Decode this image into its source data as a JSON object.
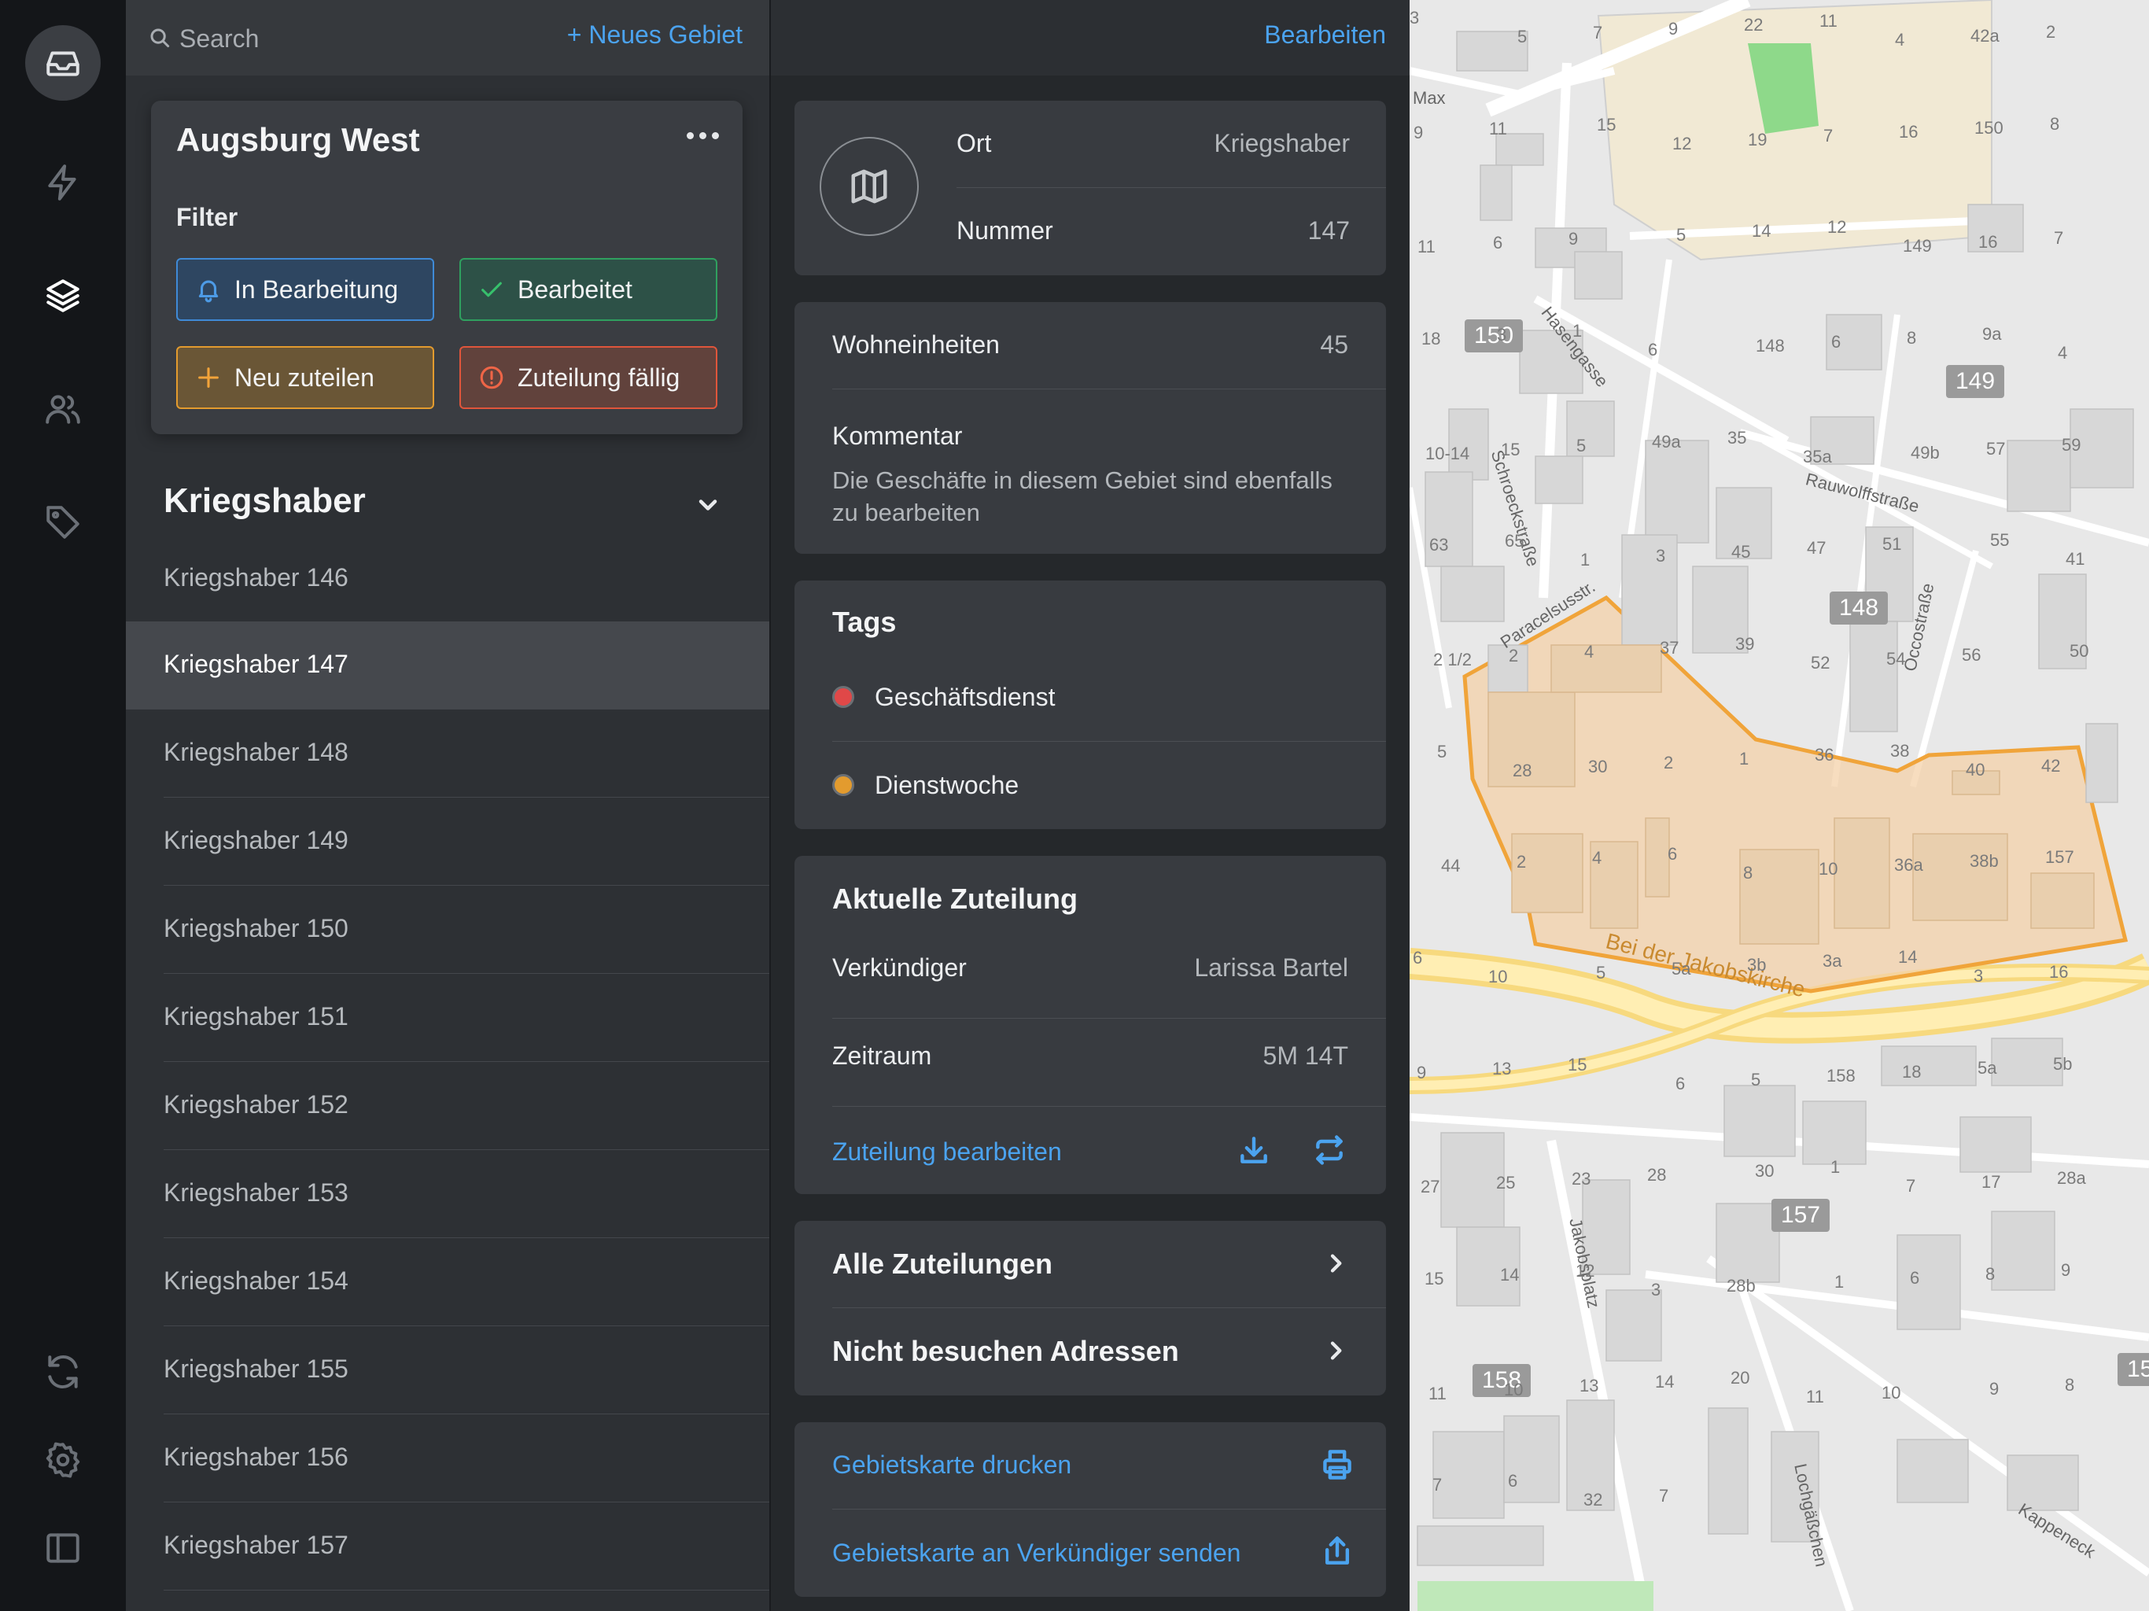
{
  "sidebar_rail": {
    "icons": [
      "inbox-icon",
      "bolt-icon",
      "layers-icon",
      "users-icon",
      "tag-icon",
      "sync-icon",
      "gear-icon",
      "sidebar-toggle-icon"
    ],
    "active": "layers-icon"
  },
  "list_pane": {
    "search_placeholder": "Search",
    "new_area_label": "+ Neues Gebiet",
    "filter_card": {
      "title": "Augsburg West",
      "filter_label": "Filter",
      "chips": [
        {
          "label": "In Bearbeitung",
          "icon": "bell-icon",
          "color": "#3f8ad6"
        },
        {
          "label": "Bearbeitet",
          "icon": "check-icon",
          "color": "#2fa05f"
        },
        {
          "label": "Neu zuteilen",
          "icon": "plus-icon",
          "color": "#e39b2e"
        },
        {
          "label": "Zuteilung fällig",
          "icon": "alert-circle-icon",
          "color": "#e0553b"
        }
      ]
    },
    "section_title": "Kriegshaber",
    "items": [
      "Kriegshaber 146",
      "Kriegshaber 147",
      "Kriegshaber 148",
      "Kriegshaber 149",
      "Kriegshaber 150",
      "Kriegshaber 151",
      "Kriegshaber 152",
      "Kriegshaber 153",
      "Kriegshaber 154",
      "Kriegshaber 155",
      "Kriegshaber 156",
      "Kriegshaber 157"
    ],
    "selected_item": "Kriegshaber 147"
  },
  "detail": {
    "edit_label": "Bearbeiten",
    "ort_label": "Ort",
    "ort_value": "Kriegshaber",
    "nummer_label": "Nummer",
    "nummer_value": "147",
    "wohneinheiten_label": "Wohneinheiten",
    "wohneinheiten_value": "45",
    "kommentar_label": "Kommentar",
    "kommentar_text": "Die Geschäfte in diesem Gebiet sind ebenfalls zu bearbeiten",
    "tags_title": "Tags",
    "tags": [
      {
        "label": "Geschäftsdienst",
        "color": "#e04848"
      },
      {
        "label": "Dienstwoche",
        "color": "#e39b2e"
      }
    ],
    "assignment": {
      "title": "Aktuelle Zuteilung",
      "verkuendiger_label": "Verkündiger",
      "verkuendiger_value": "Larissa Bartel",
      "zeitraum_label": "Zeitraum",
      "zeitraum_value": "5M 14T",
      "edit_link": "Zuteilung bearbeiten"
    },
    "all_assignments": "Alle Zuteilungen",
    "do_not_visit": "Nicht besuchen Adressen",
    "print_map": "Gebietskarte drucken",
    "send_map": "Gebietskarte an Verkündiger senden",
    "accent": "#4ba3ef"
  },
  "map": {
    "area_badges": [
      "150",
      "149",
      "148",
      "157",
      "158",
      "15"
    ],
    "streets": [
      "Hasengasse",
      "Schroeckstraße",
      "Paracelsusstr.",
      "Rauwolffstraße",
      "Occostraße",
      "Bei der Jakobskirche",
      "Jakobsplatz",
      "Lochgäßchen",
      "Kappeneck",
      "Max"
    ],
    "numbers": [
      "3",
      "5",
      "7",
      "9",
      "22",
      "11",
      "4",
      "42a",
      "2",
      "9",
      "11",
      "15",
      "12",
      "19",
      "7",
      "16",
      "150",
      "8",
      "11",
      "6",
      "9",
      "5",
      "14",
      "12",
      "149",
      "16",
      "7",
      "18",
      "3",
      "1",
      "6",
      "148",
      "6",
      "8",
      "9a",
      "4",
      "10-14",
      "15",
      "5",
      "49a",
      "35",
      "35a",
      "49b",
      "57",
      "59",
      "63",
      "65",
      "1",
      "3",
      "45",
      "47",
      "51",
      "55",
      "41",
      "2 1/2",
      "2",
      "4",
      "37",
      "39",
      "52",
      "54",
      "56",
      "50",
      "5",
      "28",
      "30",
      "2",
      "1",
      "36",
      "38",
      "40",
      "42",
      "44",
      "2",
      "4",
      "6",
      "8",
      "10",
      "36a",
      "38b",
      "157",
      "6",
      "10",
      "5",
      "5a",
      "3b",
      "3a",
      "14",
      "3",
      "16",
      "9",
      "13",
      "15",
      "6",
      "5",
      "158",
      "18",
      "5a",
      "5b",
      "27",
      "25",
      "23",
      "28",
      "30",
      "1",
      "7",
      "17",
      "28a",
      "15",
      "14",
      "12",
      "3",
      "28b",
      "1",
      "6",
      "8",
      "9",
      "11",
      "10",
      "13",
      "14",
      "20",
      "11",
      "10",
      "9",
      "8",
      "7",
      "6",
      "32",
      "7"
    ],
    "highlight_color": "#f0a43a"
  }
}
